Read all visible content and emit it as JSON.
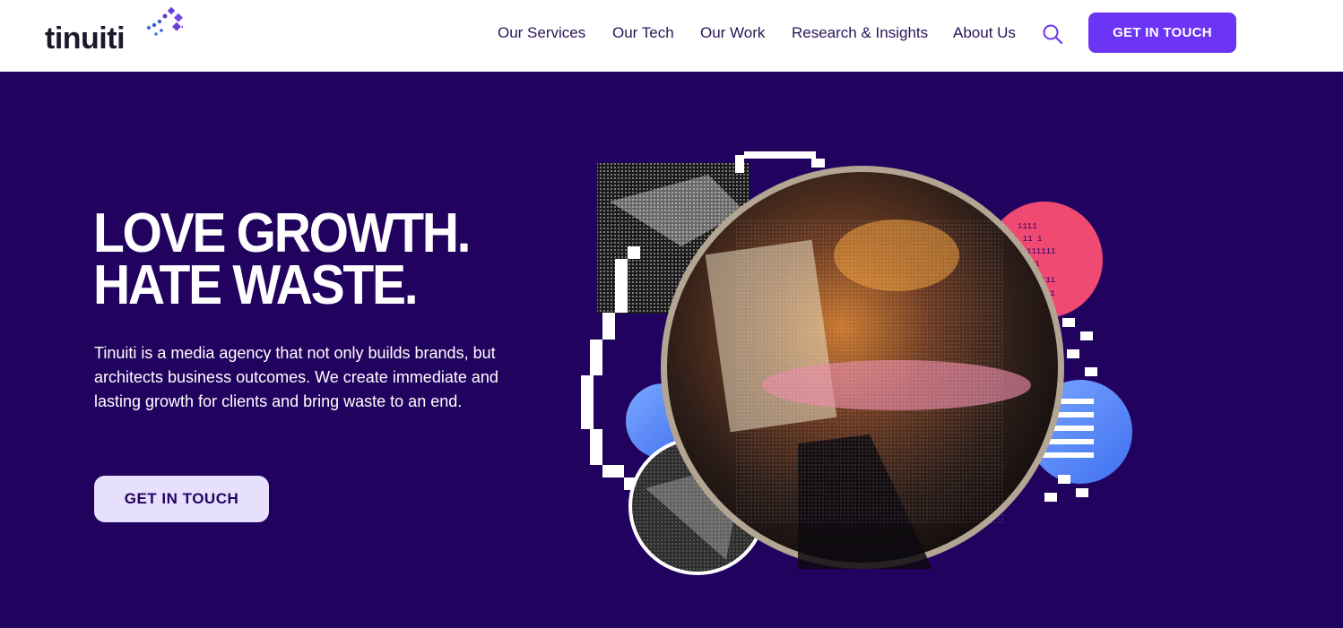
{
  "brand": {
    "name": "tinuiti",
    "accent": "#6c35f5",
    "hero_bg": "#22025f"
  },
  "nav": {
    "items": [
      {
        "label": "Our Services"
      },
      {
        "label": "Our Tech"
      },
      {
        "label": "Our Work"
      },
      {
        "label": "Research & Insights"
      },
      {
        "label": "About Us"
      }
    ],
    "search_icon": "search-icon",
    "cta_label": "GET IN TOUCH"
  },
  "hero": {
    "headline_line1": "LOVE GROWTH.",
    "headline_line2": "HATE WASTE.",
    "description": "Tinuiti is a media agency that not only builds brands, but architects business outcomes. We create immediate and lasting growth for clients and bring waste to an end.",
    "cta_label": "GET IN TOUCH",
    "image_subject": "collage-portrait"
  }
}
